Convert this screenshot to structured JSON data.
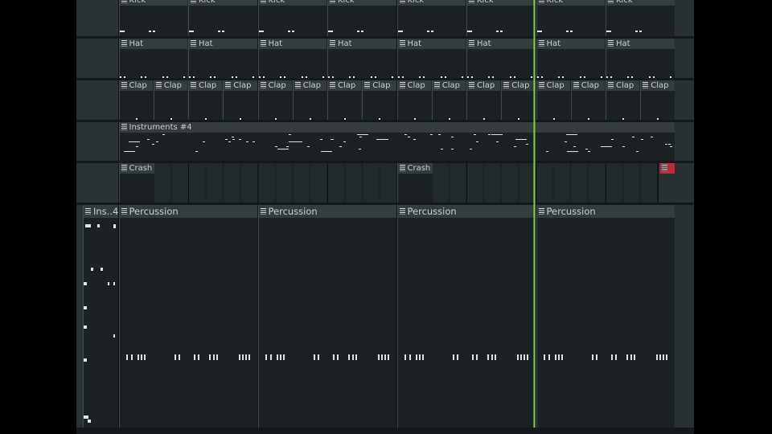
{
  "tracks": [
    {
      "id": "kick",
      "clips": [
        {
          "label": "Kick",
          "bar": 0
        },
        {
          "label": "Kick",
          "bar": 1
        },
        {
          "label": "Kick",
          "bar": 2
        },
        {
          "label": "Kick",
          "bar": 3
        },
        {
          "label": "Kick",
          "bar": 4
        },
        {
          "label": "Kick",
          "bar": 5
        },
        {
          "label": "Kick",
          "bar": 6
        },
        {
          "label": "Kick",
          "bar": 7
        }
      ]
    },
    {
      "id": "hat",
      "clips": [
        {
          "label": "Hat",
          "bar": 0
        },
        {
          "label": "Hat",
          "bar": 1
        },
        {
          "label": "Hat",
          "bar": 2
        },
        {
          "label": "Hat",
          "bar": 3
        },
        {
          "label": "Hat",
          "bar": 4
        },
        {
          "label": "Hat",
          "bar": 5
        },
        {
          "label": "Hat",
          "bar": 6
        },
        {
          "label": "Hat",
          "bar": 7
        }
      ]
    },
    {
      "id": "clap",
      "clip_label": "Clap",
      "clip_count": 16
    },
    {
      "id": "instruments",
      "clip_label": "Instruments #4"
    },
    {
      "id": "crash",
      "clips": [
        {
          "label": "Crash",
          "bar": 0
        },
        {
          "label": "Crash",
          "bar": 4
        }
      ]
    }
  ],
  "bottom_track": {
    "ins_label": "Ins..4",
    "percussion_clips": [
      {
        "label": "Percussion"
      },
      {
        "label": "Percussion"
      },
      {
        "label": "Percussion"
      },
      {
        "label": "Percussion"
      }
    ]
  },
  "colors": {
    "playhead": "#8fe23a",
    "clip_header": "#343c40",
    "clip_text": "#c9ced1",
    "red_clip": "#c02a38"
  }
}
